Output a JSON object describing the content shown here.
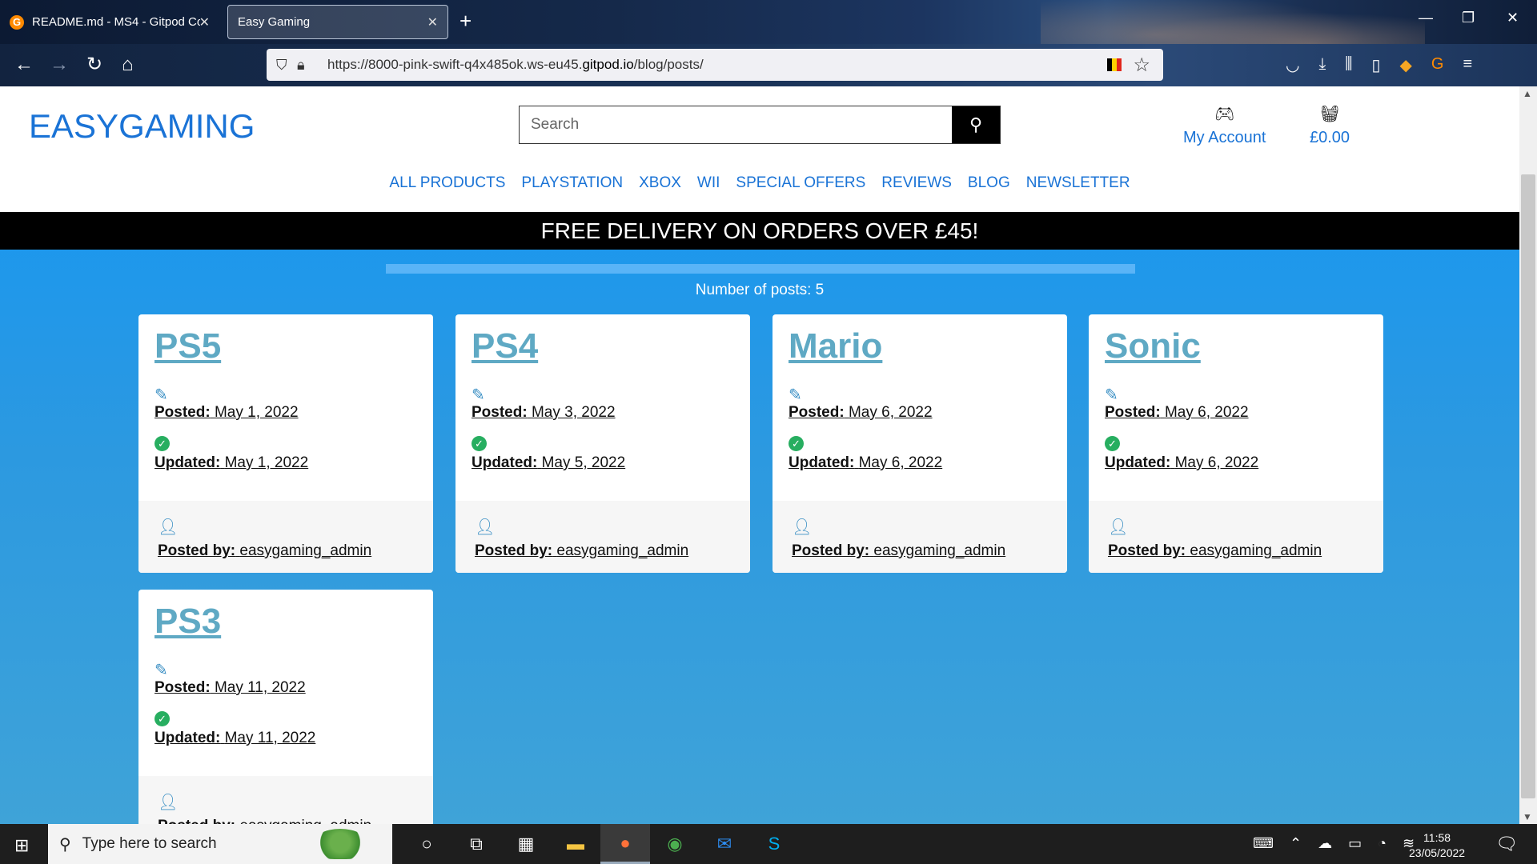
{
  "browser": {
    "tabs": [
      {
        "title": "README.md - MS4 - Gitpod Co",
        "close": "✕"
      },
      {
        "title": "Easy Gaming",
        "close": "✕"
      }
    ],
    "new_tab": "+",
    "url_prefix": "https://8000-pink-swift-q4x485ok.ws-eu45.",
    "url_domain": "gitpod.io",
    "url_suffix": "/blog/posts/"
  },
  "site": {
    "logo_part1": "EASY",
    "logo_part2": "GAMING",
    "search_placeholder": "Search",
    "account_label": "My Account",
    "basket_total": "£0.00",
    "nav": [
      "ALL PRODUCTS",
      "PLAYSTATION",
      "XBOX",
      "WII",
      "SPECIAL OFFERS",
      "REVIEWS",
      "BLOG",
      "NEWSLETTER"
    ],
    "banner": "FREE DELIVERY ON ORDERS OVER £45!",
    "post_count": "Number of posts: 5",
    "colors": {
      "brand": "#1a73d6",
      "background": "#1396f5",
      "title": "#5fa9c4"
    }
  },
  "posts": [
    {
      "title": "PS5",
      "posted_label": "Posted:",
      "posted": "May 1, 2022",
      "updated_label": "Updated:",
      "updated": "May 1, 2022",
      "by_label": "Posted by:",
      "by": "easygaming_admin"
    },
    {
      "title": "PS4",
      "posted_label": "Posted:",
      "posted": "May 3, 2022",
      "updated_label": "Updated:",
      "updated": "May 5, 2022",
      "by_label": "Posted by:",
      "by": "easygaming_admin"
    },
    {
      "title": "Mario",
      "posted_label": "Posted:",
      "posted": "May 6, 2022",
      "updated_label": "Updated:",
      "updated": "May 6, 2022",
      "by_label": "Posted by:",
      "by": "easygaming_admin"
    },
    {
      "title": "Sonic",
      "posted_label": "Posted:",
      "posted": "May 6, 2022",
      "updated_label": "Updated:",
      "updated": "May 6, 2022",
      "by_label": "Posted by:",
      "by": "easygaming_admin"
    },
    {
      "title": "PS3",
      "posted_label": "Posted:",
      "posted": "May 11, 2022",
      "updated_label": "Updated:",
      "updated": "May 11, 2022",
      "by_label": "Posted by:",
      "by": "easygaming_admin"
    }
  ],
  "taskbar": {
    "search_placeholder": "Type here to search",
    "time": "11:58",
    "date": "23/05/2022"
  }
}
